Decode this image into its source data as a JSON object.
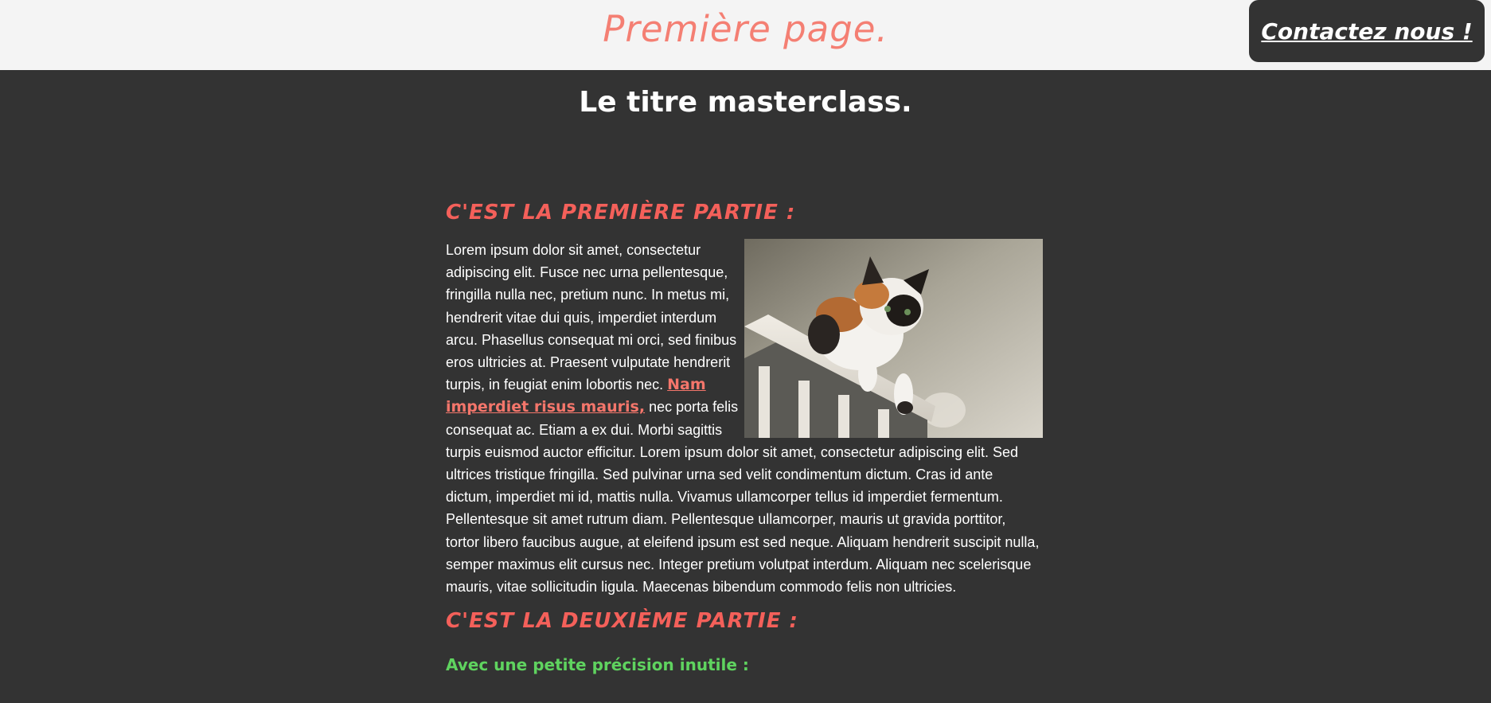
{
  "header": {
    "page_title": "Première page.",
    "contact_label": "Contactez nous !"
  },
  "main": {
    "title": "Le titre masterclass."
  },
  "section1": {
    "heading": "C'EST LA PREMIÈRE PARTIE :",
    "text_before_link": "Lorem ipsum dolor sit amet, consectetur adipiscing elit. Fusce nec urna pellentesque, fringilla nulla nec, pretium nunc. In metus mi, hendrerit vitae dui quis, imperdiet interdum arcu. Phasellus consequat mi orci, sed finibus eros ultricies at. Praesent vulputate hendrerit turpis, in feugiat enim lobortis nec.",
    "link_text": "Nam imperdiet risus mauris,",
    "text_after_link": " nec porta felis consequat ac. Etiam a ex dui. Morbi sagittis turpis euismod auctor efficitur. Lorem ipsum dolor sit amet, consectetur adipiscing elit. Sed ultrices tristique fringilla. Sed pulvinar urna sed velit condimentum dictum. Cras id ante dictum, imperdiet mi id, mattis nulla. Vivamus ullamcorper tellus id imperdiet fermentum. Pellentesque sit amet rutrum diam. Pellentesque ullamcorper, mauris ut gravida porttitor, tortor libero faucibus augue, at eleifend ipsum est sed neque. Aliquam hendrerit suscipit nulla, semper maximus elit cursus nec. Integer pretium volutpat interdum. Aliquam nec scelerisque mauris, vitae sollicitudin ligula. Maecenas bibendum commodo felis non ultricies."
  },
  "section2": {
    "heading": "C'EST LA DEUXIÈME PARTIE :",
    "subheading": "Avec une petite précision inutile :"
  },
  "colors": {
    "header_bg": "#f4f4f4",
    "page_bg": "#333333",
    "accent_salmon": "#f47f73",
    "section_red": "#f4605a",
    "sub_green": "#5fd35f"
  }
}
